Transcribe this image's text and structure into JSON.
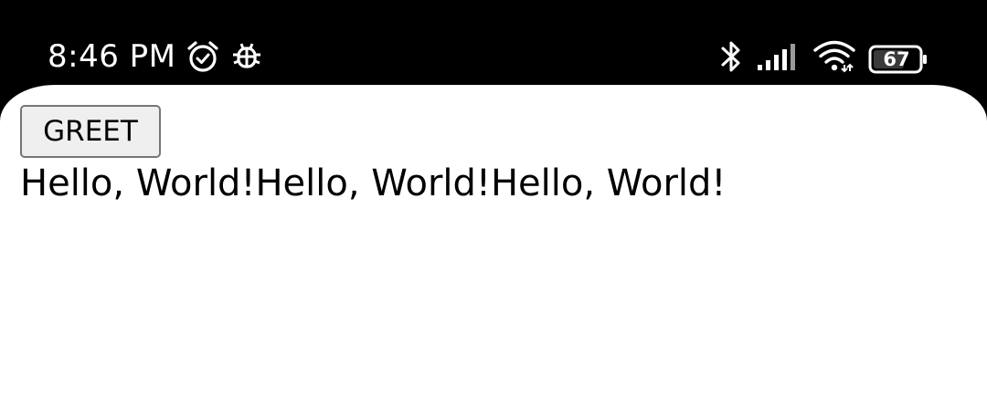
{
  "status_bar": {
    "time": "8:46 PM",
    "left_icons": [
      "alarm-icon",
      "bug-icon"
    ],
    "right_icons": [
      "bluetooth-icon",
      "signal-icon",
      "wifi-icon",
      "battery-icon"
    ],
    "battery_level": "67"
  },
  "app": {
    "greet_button_label": "GREET",
    "output_text": "Hello, World!Hello, World!Hello, World!"
  }
}
